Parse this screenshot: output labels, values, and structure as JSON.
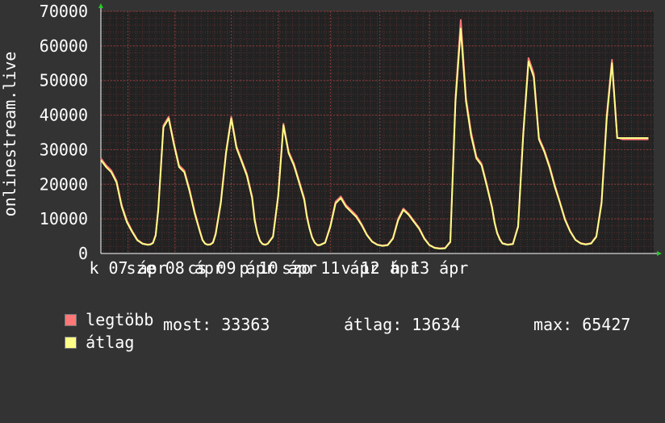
{
  "colors": {
    "background": "#333333",
    "plot": "#222222",
    "grid_minor": "#5a3030",
    "grid_major": "#8a3a3a",
    "max_series": "#ff7777",
    "avg_series": "#ffff88",
    "text": "#ffffff"
  },
  "legend": {
    "max_label": "legtöbb",
    "avg_label": "átlag",
    "stats": [
      {
        "label": "most: 33363"
      },
      {
        "label": "átlag: 13634"
      },
      {
        "label": "max: 65427"
      }
    ]
  },
  "chart_data": {
    "type": "line",
    "ylabel": "onlinestream.live",
    "ylim": [
      0,
      70000
    ],
    "yticks": [
      0,
      10000,
      20000,
      30000,
      40000,
      50000,
      60000,
      70000
    ],
    "ytick_labels": [
      "0",
      "10000",
      "20000",
      "30000",
      "40000",
      "50000",
      "60000",
      "70000"
    ],
    "xlim": [
      -2.8,
      7.8
    ],
    "xtick_labels": [
      {
        "x": -2.28,
        "text": "k 07 ápr"
      },
      {
        "x": -1.38,
        "text": "sze 08 ápr"
      },
      {
        "x": -0.3,
        "text": "cs 09 ápr"
      },
      {
        "x": 0.6,
        "text": "p 10 ápr"
      },
      {
        "x": 1.6,
        "text": "szo 11 ápr"
      },
      {
        "x": 2.55,
        "text": "v 12 ápr"
      },
      {
        "x": 3.5,
        "text": "h 13 ápr"
      }
    ],
    "grid": true,
    "legend": "bottom",
    "series": [
      {
        "name": "legtöbb",
        "x": [
          -2.8,
          -2.7,
          -2.6,
          -2.5,
          -2.4,
          -2.3,
          -2.2,
          -2.1,
          -2.0,
          -1.9,
          -1.85,
          -1.8,
          -1.75,
          -1.7,
          -1.65,
          -1.6,
          -1.5,
          -1.4,
          -1.3,
          -1.2,
          -1.1,
          -1.0,
          -0.9,
          -0.85,
          -0.8,
          -0.75,
          -0.7,
          -0.65,
          -0.6,
          -0.5,
          -0.4,
          -0.3,
          -0.2,
          -0.1,
          0.0,
          0.1,
          0.15,
          0.2,
          0.25,
          0.3,
          0.35,
          0.4,
          0.5,
          0.6,
          0.7,
          0.8,
          0.9,
          1.0,
          1.1,
          1.15,
          1.2,
          1.25,
          1.3,
          1.35,
          1.4,
          1.5,
          1.6,
          1.7,
          1.8,
          1.9,
          2.0,
          2.1,
          2.2,
          2.3,
          2.4,
          2.5,
          2.6,
          2.7,
          2.8,
          2.9,
          3.0,
          3.1,
          3.2,
          3.3,
          3.4,
          3.5,
          3.6,
          3.7,
          3.8,
          3.9,
          4.0,
          4.1,
          4.2,
          4.3,
          4.4,
          4.5,
          4.6,
          4.7,
          4.75,
          4.8,
          4.85,
          4.9,
          5.0,
          5.1,
          5.2,
          5.3,
          5.4,
          5.5,
          5.6,
          5.7,
          5.8,
          5.9,
          6.0,
          6.1,
          6.2,
          6.3,
          6.4,
          6.5,
          6.6,
          6.7,
          6.8,
          6.9,
          7.0,
          7.1,
          7.2,
          7.3,
          7.4,
          7.5,
          7.6,
          7.7
        ],
        "values": [
          27500,
          25500,
          24000,
          21000,
          14000,
          9500,
          6500,
          4000,
          2900,
          2600,
          2700,
          3200,
          5500,
          13000,
          25000,
          37000,
          39500,
          32000,
          25500,
          24000,
          18500,
          12000,
          6500,
          4000,
          2900,
          2600,
          2700,
          3300,
          5800,
          15000,
          29500,
          39500,
          31000,
          27000,
          23000,
          16500,
          10000,
          6000,
          3800,
          2800,
          2600,
          2900,
          5000,
          17000,
          37500,
          29500,
          26000,
          21000,
          16000,
          11000,
          7500,
          4800,
          3200,
          2500,
          2500,
          3200,
          8000,
          15000,
          16500,
          14000,
          12500,
          11000,
          8500,
          5500,
          3500,
          2600,
          2300,
          2500,
          4500,
          10000,
          13000,
          11500,
          9500,
          7500,
          4500,
          2500,
          1700,
          1500,
          1600,
          3500,
          45000,
          67500,
          45000,
          35000,
          28000,
          26000,
          20000,
          13500,
          9000,
          6000,
          4200,
          3000,
          2600,
          2800,
          8000,
          35000,
          56500,
          52000,
          33500,
          30000,
          25500,
          20000,
          15000,
          10000,
          6500,
          4000,
          3000,
          2700,
          3000,
          5000,
          15000,
          40000,
          56000,
          33500,
          33000,
          33000,
          33000,
          33000,
          33000,
          33000
        ]
      },
      {
        "name": "átlag",
        "x": [
          -2.8,
          -2.7,
          -2.6,
          -2.5,
          -2.4,
          -2.3,
          -2.2,
          -2.1,
          -2.0,
          -1.9,
          -1.85,
          -1.8,
          -1.75,
          -1.7,
          -1.65,
          -1.6,
          -1.5,
          -1.4,
          -1.3,
          -1.2,
          -1.1,
          -1.0,
          -0.9,
          -0.85,
          -0.8,
          -0.75,
          -0.7,
          -0.65,
          -0.6,
          -0.5,
          -0.4,
          -0.3,
          -0.2,
          -0.1,
          0.0,
          0.1,
          0.15,
          0.2,
          0.25,
          0.3,
          0.35,
          0.4,
          0.5,
          0.6,
          0.7,
          0.8,
          0.9,
          1.0,
          1.1,
          1.15,
          1.2,
          1.25,
          1.3,
          1.35,
          1.4,
          1.5,
          1.6,
          1.7,
          1.8,
          1.9,
          2.0,
          2.1,
          2.2,
          2.3,
          2.4,
          2.5,
          2.6,
          2.7,
          2.8,
          2.9,
          3.0,
          3.1,
          3.2,
          3.3,
          3.4,
          3.5,
          3.6,
          3.7,
          3.8,
          3.9,
          4.0,
          4.1,
          4.2,
          4.3,
          4.4,
          4.5,
          4.6,
          4.7,
          4.75,
          4.8,
          4.85,
          4.9,
          5.0,
          5.1,
          5.2,
          5.3,
          5.4,
          5.5,
          5.6,
          5.7,
          5.8,
          5.9,
          6.0,
          6.1,
          6.2,
          6.3,
          6.4,
          6.5,
          6.6,
          6.7,
          6.8,
          6.9,
          7.0,
          7.1,
          7.2,
          7.3,
          7.4,
          7.5,
          7.6,
          7.7
        ],
        "values": [
          27000,
          25000,
          23500,
          20500,
          13500,
          9000,
          6200,
          3800,
          2800,
          2500,
          2600,
          3000,
          5200,
          12500,
          24500,
          36500,
          39000,
          31500,
          25000,
          23500,
          18000,
          11500,
          6200,
          3800,
          2800,
          2500,
          2600,
          3100,
          5500,
          14500,
          29000,
          39000,
          30500,
          26500,
          22500,
          16000,
          9500,
          5800,
          3600,
          2700,
          2500,
          2800,
          4800,
          16500,
          37000,
          29000,
          25500,
          20500,
          15500,
          10500,
          7200,
          4600,
          3100,
          2400,
          2400,
          3100,
          7700,
          14500,
          16000,
          13500,
          12000,
          10500,
          8200,
          5300,
          3400,
          2500,
          2200,
          2400,
          4300,
          9600,
          12600,
          11200,
          9200,
          7200,
          4300,
          2400,
          1600,
          1400,
          1500,
          3300,
          44000,
          65000,
          44000,
          34000,
          27500,
          25500,
          19500,
          13200,
          8800,
          5800,
          4000,
          2900,
          2500,
          2700,
          7700,
          34500,
          55500,
          51000,
          33000,
          29500,
          25000,
          19500,
          14700,
          9700,
          6300,
          3900,
          2900,
          2600,
          2900,
          4800,
          14500,
          39000,
          55000,
          33363,
          33363,
          33363,
          33363,
          33363,
          33363,
          33363
        ]
      }
    ]
  }
}
